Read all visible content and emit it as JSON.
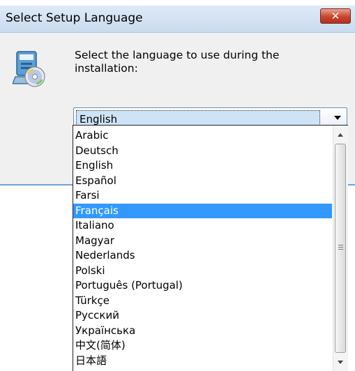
{
  "window": {
    "title": "Select Setup Language",
    "close_glyph": "✕"
  },
  "dialog": {
    "icon": "setup-disc-icon",
    "prompt": "Select the language to use during the installation:"
  },
  "language_select": {
    "selected_value": "English",
    "highlighted": "Français",
    "options": [
      "Arabic",
      "Deutsch",
      "English",
      "Español",
      "Farsi",
      "Français",
      "Italiano",
      "Magyar",
      "Nederlands",
      "Polski",
      "Português (Portugal)",
      "Türkçe",
      "Русский",
      "Українська",
      "中文(简体)",
      "日本語"
    ]
  },
  "colors": {
    "highlight": "#3399ff",
    "dialog_bg": "#f0f0f0",
    "close_button": "#c8452f"
  }
}
